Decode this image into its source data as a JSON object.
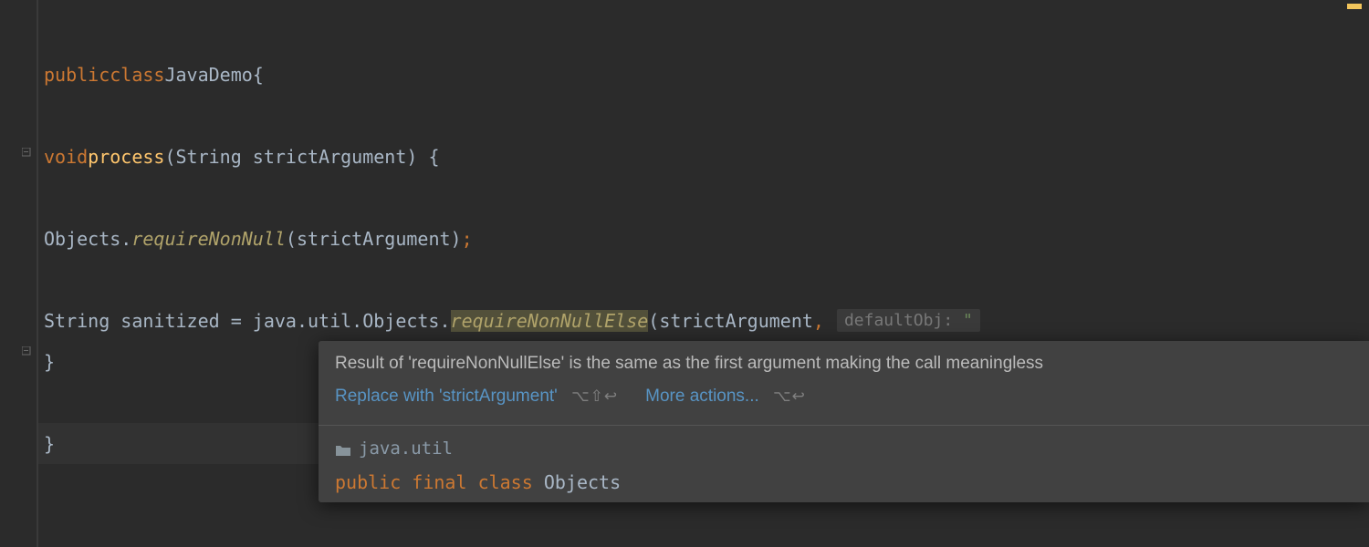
{
  "code": {
    "line1_public": "public",
    "line1_class": "class",
    "line1_name": "JavaDemo",
    "line1_brace": "{",
    "line3_void": "void",
    "line3_method": "process",
    "line3_sig_open": "(String strictArgument) {",
    "line5_call_prefix": "Objects.",
    "line5_call_method": "requireNonNull",
    "line5_call_args": "(strictArgument)",
    "line5_semi": ";",
    "line7_prefix": "String sanitized = java.util.Objects.",
    "line7_method": "requireNonNullElse",
    "line7_args_open": "(strictArgument",
    "line7_comma": ",",
    "line7_hint_label": "defaultObj:",
    "line7_string": "\"",
    "line8_brace": "}",
    "line10_brace": "}"
  },
  "popup": {
    "message": "Result of 'requireNonNullElse' is the same as the first argument making the call meaningless",
    "action1": "Replace with 'strictArgument'",
    "shortcut1": "⌥⇧↩",
    "action2": "More actions...",
    "shortcut2": "⌥↩",
    "package": "java.util",
    "decl_public": "public",
    "decl_final": "final",
    "decl_class": "class",
    "decl_name": "Objects"
  }
}
